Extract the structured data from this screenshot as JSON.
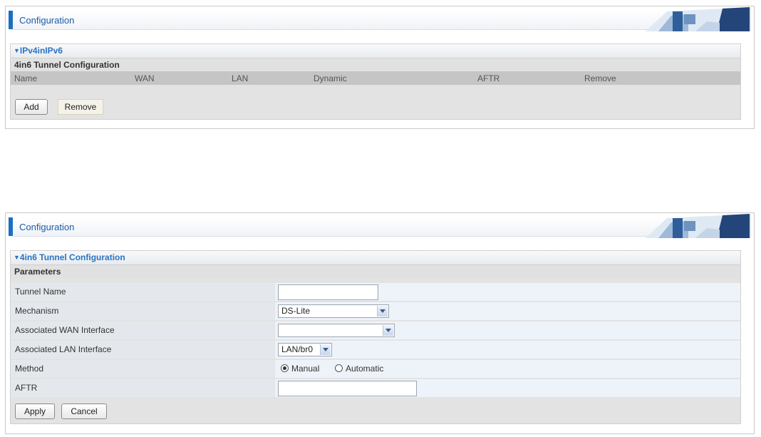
{
  "panel1": {
    "title": "Configuration",
    "section_title": "IPv4inIPv6",
    "subsection": "4in6 Tunnel Configuration",
    "columns": [
      "Name",
      "WAN",
      "LAN",
      "Dynamic",
      "AFTR",
      "Remove"
    ],
    "add_label": "Add",
    "remove_label": "Remove"
  },
  "panel2": {
    "title": "Configuration",
    "section_title": "4in6 Tunnel Configuration",
    "subsection": "Parameters",
    "rows": {
      "tunnel_name": {
        "label": "Tunnel Name",
        "value": ""
      },
      "mechanism": {
        "label": "Mechanism",
        "value": "DS-Lite"
      },
      "wan_interface": {
        "label": "Associated WAN Interface",
        "value": ""
      },
      "lan_interface": {
        "label": "Associated LAN Interface",
        "value": "LAN/br0"
      },
      "method": {
        "label": "Method",
        "options": [
          "Manual",
          "Automatic"
        ],
        "selected": "Manual"
      },
      "aftr": {
        "label": "AFTR",
        "value": ""
      }
    },
    "apply_label": "Apply",
    "cancel_label": "Cancel"
  },
  "icons": {
    "section_toggle": "triangle-down-icon",
    "dropdown": "chevron-down-icon",
    "banner": "router-banner-icon"
  },
  "colors": {
    "accent": "#1a6fc1",
    "title_text": "#1a5ca8",
    "section_title": "#2a74c2",
    "column_bar": "#c5c5c5"
  }
}
